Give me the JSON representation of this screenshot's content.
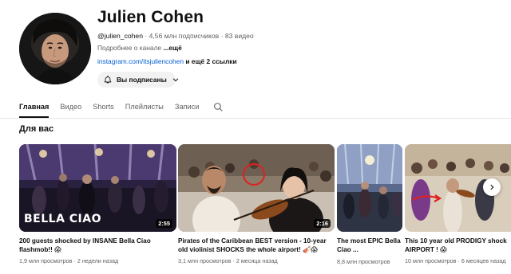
{
  "channel": {
    "name": "Julien Cohen",
    "handle": "@julien_cohen",
    "stats": " · 4,56 млн подписчиков · 83 видео",
    "about_text": "Подробнее о канале ",
    "about_more": "...ещё",
    "link": "instagram.com/itsjuliencohen",
    "links_extra": " и ещё 2 ссылки",
    "subscribed_label": "Вы подписаны",
    "avatar_icon": "avatar"
  },
  "tabs": [
    {
      "label": "Главная",
      "active": true
    },
    {
      "label": "Видео",
      "active": false
    },
    {
      "label": "Shorts",
      "active": false
    },
    {
      "label": "Плейлисты",
      "active": false
    },
    {
      "label": "Записи",
      "active": false
    }
  ],
  "icons": {
    "search": "search-icon",
    "bell": "bell-icon",
    "chevron": "chevron-down-icon",
    "next": "chevron-right-icon"
  },
  "section": {
    "title": "Для вас"
  },
  "videos": [
    {
      "title": "200 guests shocked by INSANE Bella Ciao flashmob!! 😱",
      "meta": "1,9 млн просмотров · 2 недели назад",
      "duration": "2:55",
      "overlay_text": "BELLA CIAO"
    },
    {
      "title": "Pirates of the Caribbean BEST version - 10-year old violinist SHOCKS the whole airport! 🎻😱",
      "meta": "3,1 млн просмотров · 2 месяца назад",
      "duration": "2:16"
    },
    {
      "title": "The most EPIC Bella Ciao ...",
      "meta": "8,8 млн просмотров"
    },
    {
      "title": "This 10 year old PRODIGY shock AIRPORT ! 😱",
      "meta": "10 млн просмотров · 6 месяцев назад"
    }
  ],
  "colors": {
    "link": "#065fd4",
    "text": "#0f0f0f",
    "secondary": "#606060",
    "chip": "#f2f2f2"
  }
}
